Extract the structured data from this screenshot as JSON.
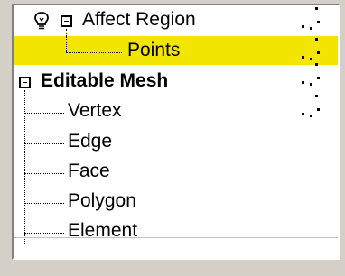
{
  "stack": {
    "modifier": {
      "label": "Affect Region",
      "icon": "lightbulb-icon",
      "sub_object": "Points"
    },
    "base_object": {
      "label": "Editable Mesh",
      "sub_objects": [
        "Vertex",
        "Edge",
        "Face",
        "Polygon",
        "Element"
      ]
    }
  },
  "colors": {
    "selection_highlight": "#f2e600",
    "panel_background": "#ffffff",
    "window_background": "#d4d0c8"
  }
}
